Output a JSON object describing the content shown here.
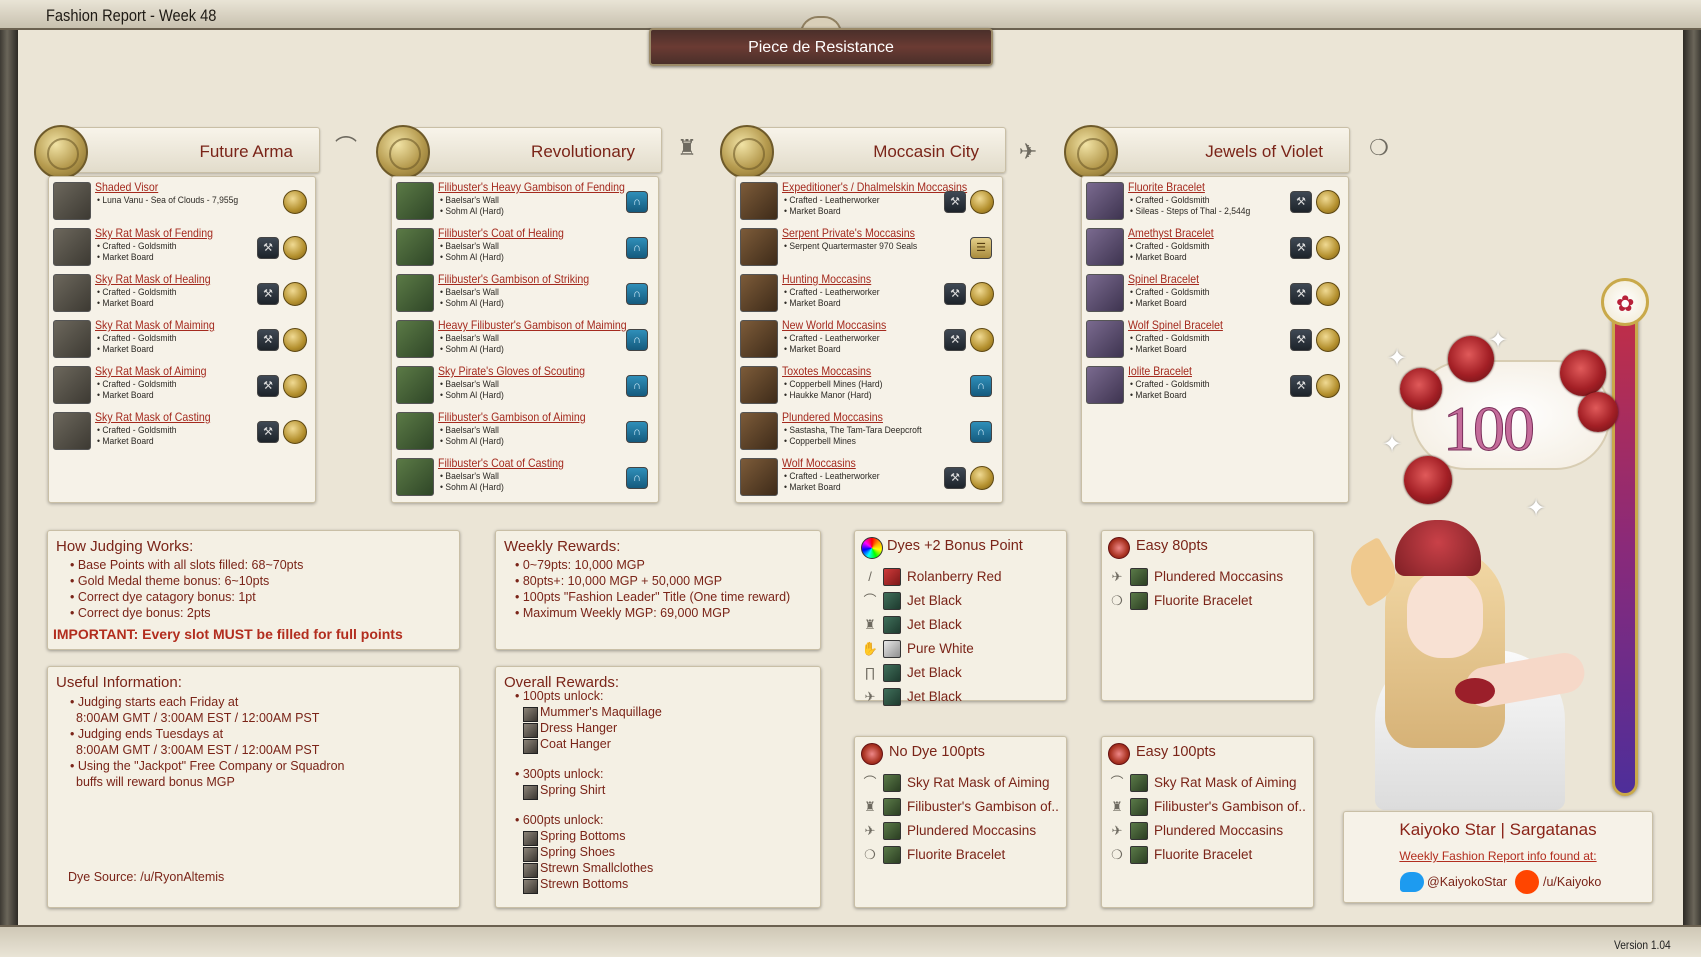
{
  "window": {
    "title": "Fashion Report - Week 48",
    "version": "Version 1.04"
  },
  "theme": {
    "name": "Piece de Resistance"
  },
  "slots": [
    {
      "title": "Future Arma",
      "icon": "head-slot-icon",
      "items": [
        {
          "name": "Shaded Visor",
          "l1": "• Luna Vanu - Sea of Clouds - 7,955g",
          "l2": "",
          "icons": [
            "gil"
          ]
        },
        {
          "name": "Sky Rat Mask of Fending",
          "l1": "• Crafted - Goldsmith",
          "l2": "• Market Board",
          "icons": [
            "gear",
            "gil"
          ]
        },
        {
          "name": "Sky Rat Mask of Healing",
          "l1": "• Crafted - Goldsmith",
          "l2": "• Market Board",
          "icons": [
            "gear",
            "gil"
          ]
        },
        {
          "name": "Sky Rat Mask of Maiming",
          "l1": "• Crafted - Goldsmith",
          "l2": "• Market Board",
          "icons": [
            "gear",
            "gil"
          ]
        },
        {
          "name": "Sky Rat Mask of Aiming",
          "l1": "• Crafted - Goldsmith",
          "l2": "• Market Board",
          "icons": [
            "gear",
            "gil"
          ]
        },
        {
          "name": "Sky Rat Mask of Casting",
          "l1": "• Crafted - Goldsmith",
          "l2": "• Market Board",
          "icons": [
            "gear",
            "gil"
          ]
        }
      ]
    },
    {
      "title": "Revolutionary",
      "icon": "body-slot-icon",
      "items": [
        {
          "name": "Filibuster's Heavy Gambison of Fending",
          "l1": "• Baelsar's Wall",
          "l2": "• Sohm Al (Hard)",
          "icons": [
            "blue"
          ]
        },
        {
          "name": "Filibuster's Coat of Healing",
          "l1": "• Baelsar's Wall",
          "l2": "• Sohm Al (Hard)",
          "icons": [
            "blue"
          ]
        },
        {
          "name": "Filibuster's Gambison of Striking",
          "l1": "• Baelsar's Wall",
          "l2": "• Sohm Al (Hard)",
          "icons": [
            "blue"
          ]
        },
        {
          "name": "Heavy Filibuster's Gambison of Maiming",
          "l1": "• Baelsar's Wall",
          "l2": "• Sohm Al (Hard)",
          "icons": [
            "blue"
          ]
        },
        {
          "name": "Sky Pirate's Gloves of Scouting",
          "l1": "• Baelsar's Wall",
          "l2": "• Sohm Al (Hard)",
          "icons": [
            "blue"
          ]
        },
        {
          "name": "Filibuster's Gambison of Aiming",
          "l1": "• Baelsar's Wall",
          "l2": "• Sohm Al (Hard)",
          "icons": [
            "blue"
          ]
        },
        {
          "name": "Filibuster's Coat of Casting",
          "l1": "• Baelsar's Wall",
          "l2": "• Sohm Al (Hard)",
          "icons": [
            "blue"
          ]
        }
      ]
    },
    {
      "title": "Moccasin City",
      "icon": "feet-slot-icon",
      "items": [
        {
          "name": "Expeditioner's / Dhalmelskin Moccasins",
          "l1": "• Crafted - Leatherworker",
          "l2": "• Market Board",
          "icons": [
            "gear",
            "gil"
          ]
        },
        {
          "name": "Serpent Private's Moccasins",
          "l1": "• Serpent Quartermaster 970 Seals",
          "l2": "",
          "icons": [
            "parch"
          ]
        },
        {
          "name": "Hunting Moccasins",
          "l1": "• Crafted - Leatherworker",
          "l2": "• Market Board",
          "icons": [
            "gear",
            "gil"
          ]
        },
        {
          "name": "New World Moccasins",
          "l1": "• Crafted - Leatherworker",
          "l2": "• Market Board",
          "icons": [
            "gear",
            "gil"
          ]
        },
        {
          "name": "Toxotes Moccasins",
          "l1": "• Copperbell Mines (Hard)",
          "l2": "• Haukke Manor (Hard)",
          "icons": [
            "blue"
          ]
        },
        {
          "name": "Plundered Moccasins",
          "l1": "• Sastasha, The Tam-Tara Deepcroft",
          "l2": "• Copperbell Mines",
          "icons": [
            "blue"
          ]
        },
        {
          "name": "Wolf Moccasins",
          "l1": "• Crafted - Leatherworker",
          "l2": "• Market Board",
          "icons": [
            "gear",
            "gil"
          ]
        }
      ]
    },
    {
      "title": "Jewels of Violet",
      "icon": "bracelet-slot-icon",
      "items": [
        {
          "name": "Fluorite Bracelet",
          "l1": "• Crafted - Goldsmith",
          "l2": "• Sileas - Steps of Thal - 2,544g",
          "icons": [
            "gear",
            "gil"
          ]
        },
        {
          "name": "Amethyst Bracelet",
          "l1": "• Crafted - Goldsmith",
          "l2": "• Market Board",
          "icons": [
            "gear",
            "gil"
          ]
        },
        {
          "name": "Spinel Bracelet",
          "l1": "• Crafted - Goldsmith",
          "l2": "• Market Board",
          "icons": [
            "gear",
            "gil"
          ]
        },
        {
          "name": "Wolf Spinel Bracelet",
          "l1": "• Crafted - Goldsmith",
          "l2": "• Market Board",
          "icons": [
            "gear",
            "gil"
          ]
        },
        {
          "name": "Iolite Bracelet",
          "l1": "• Crafted - Goldsmith",
          "l2": "• Market Board",
          "icons": [
            "gear",
            "gil"
          ]
        }
      ]
    }
  ],
  "judging": {
    "title": "How Judging Works:",
    "lines": [
      "• Base Points with all slots filled: 68~70pts",
      "• Gold Medal theme bonus: 6~10pts",
      "• Correct dye catagory bonus: 1pt",
      "• Correct dye bonus: 2pts"
    ],
    "important": "IMPORTANT: Every slot MUST be filled for full points"
  },
  "useful": {
    "title": "Useful Information:",
    "lines": [
      "• Judging starts each Friday at",
      "8:00AM GMT / 3:00AM EST / 12:00AM PST",
      "• Judging ends Tuesdays at",
      "8:00AM GMT / 3:00AM EST / 12:00AM PST",
      "• Using the \"Jackpot\" Free Company or Squadron",
      "buffs will reward bonus MGP"
    ],
    "source": "Dye Source: /u/RyonAltemis"
  },
  "weekly": {
    "title": "Weekly Rewards:",
    "lines": [
      "• 0~79pts: 10,000 MGP",
      "• 80pts+: 10,000 MGP + 50,000 MGP",
      "• 100pts \"Fashion Leader\" Title (One time reward)",
      "• Maximum Weekly MGP: 69,000 MGP"
    ]
  },
  "overall": {
    "title": "Overall Rewards:",
    "groups": [
      {
        "header": "• 100pts unlock:",
        "items": [
          "Mummer's Maquillage",
          "Dress Hanger",
          "Coat Hanger"
        ]
      },
      {
        "header": "• 300pts unlock:",
        "items": [
          "Spring Shirt"
        ]
      },
      {
        "header": "• 600pts unlock:",
        "items": [
          "Spring Bottoms",
          "Spring Shoes",
          "Strewn Smallclothes",
          "Strewn Bottoms"
        ]
      }
    ]
  },
  "dyes": {
    "title": "Dyes  +2 Bonus Point",
    "rows": [
      {
        "slot": "weapon",
        "dye": "Rolanberry Red",
        "color": "red"
      },
      {
        "slot": "head",
        "dye": "Jet Black",
        "color": "black"
      },
      {
        "slot": "body",
        "dye": "Jet Black",
        "color": "black"
      },
      {
        "slot": "hands",
        "dye": "Pure White",
        "color": "white"
      },
      {
        "slot": "legs",
        "dye": "Jet Black",
        "color": "black"
      },
      {
        "slot": "feet",
        "dye": "Jet Black",
        "color": "black"
      }
    ]
  },
  "easy80": {
    "title": "Easy 80pts",
    "rows": [
      "Plundered Moccasins",
      "Fluorite Bracelet"
    ]
  },
  "nodye": {
    "title": "No Dye 100pts",
    "rows": [
      "Sky Rat Mask of Aiming",
      "Filibuster's Gambison of..",
      "Plundered Moccasins",
      "Fluorite Bracelet"
    ]
  },
  "easy100": {
    "title": "Easy 100pts",
    "rows": [
      "Sky Rat Mask of Aiming",
      "Filibuster's Gambison of..",
      "Plundered Moccasins",
      "Fluorite Bracelet"
    ]
  },
  "score": {
    "value": "100"
  },
  "credit": {
    "name": "Kaiyoko Star | Sargatanas",
    "link": "Weekly Fashion Report info found at:",
    "twitter": "@KaiyokoStar",
    "reddit": "/u/Kaiyoko"
  },
  "colors": {
    "accent": "#7a2418",
    "link": "#a42a1e",
    "theme_plate": "#5a3530",
    "gold": "#b59a4e"
  }
}
